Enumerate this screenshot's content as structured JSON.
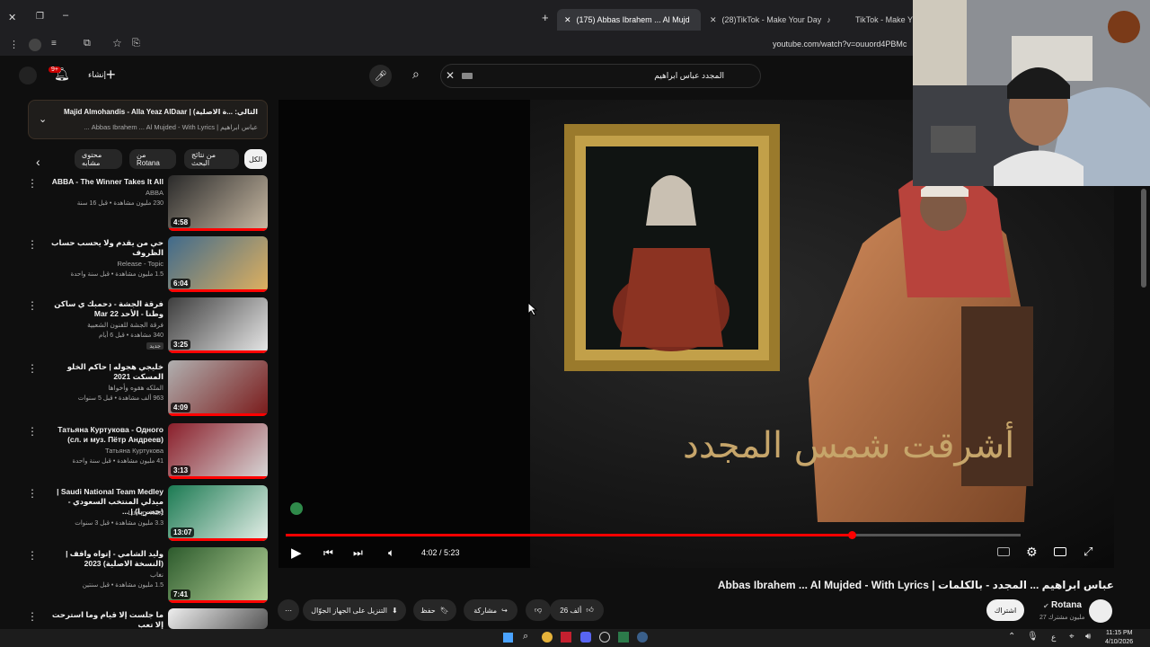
{
  "browser": {
    "tabs": [
      {
        "label": "(175) Abbas Ibrahem ... Al Mujd"
      },
      {
        "label": "(28)TikTok - Make Your Day"
      },
      {
        "label": "TikTok - Make Y"
      }
    ],
    "url": "youtube.com/watch?v=ouuord4PBMc"
  },
  "header": {
    "create_label": "إنشاء",
    "notif_count": "9+",
    "search_value": "المجدد عباس ابراهيم"
  },
  "playlist": {
    "next_label": "التالي: ...ة الاصلية) | Majid Almohandis - Alla Yeaz AlDaar",
    "sub_label": "عباس ابراهيم | Abbas Ibrahem ... Al Mujded - With Lyrics ..."
  },
  "filters": [
    "الكل",
    "من نتائج البحث",
    "من Rotana",
    "محتوى مشابه"
  ],
  "recommendations": [
    {
      "title": "ABBA - The Winner Takes It All",
      "channel": "ABBA",
      "meta": "230 مليون مشاهدة • قبل 16 سنة",
      "duration": "4:58"
    },
    {
      "title": "حي من يقدم ولا يحسب حساب الظروف",
      "channel": "Release - Topic",
      "meta": "1.5 مليون مشاهدة • قبل سنة واحدة",
      "duration": "6:04"
    },
    {
      "title": "فرقة الجشة - دحمبك ي ساكن وطنا - الأحد 22 Mar",
      "channel": "فرقة الجشة للفنون الشعبية",
      "meta": "340 مشاهدة • قبل 6 أيام",
      "duration": "3:25",
      "badge": "جديد"
    },
    {
      "title": "خليجي هجوله | حاكم الخلو المسكت 2021",
      "channel": "الملكه هقوه وأخواها",
      "meta": "963 ألف مشاهدة • قبل 5 سنوات",
      "duration": "4:09"
    },
    {
      "title": "Татьяна Куртукова - Одного (сл. и муз. Пётр Андреев)",
      "channel": "Татьяна Куртукова",
      "meta": "41 مليون مشاهدة • قبل سنة واحدة",
      "duration": "3:13"
    },
    {
      "title": "Saudi National Team Medley | ميدلي المنتخب السعودي - (حصريا) | ...",
      "channel": "Luxury KSA",
      "meta": "3.3 مليون مشاهدة • قبل 3 سنوات",
      "duration": "13:07"
    },
    {
      "title": "وليد الشامي - إتواه واقف | (النسخة الاصلية) 2023",
      "channel": "نغاب",
      "meta": "1.5 مليون مشاهدة • قبل سنتين",
      "duration": "7:41"
    },
    {
      "title": "ما جلست إلا قيام وما استرحت إلا تعب",
      "channel": "",
      "meta": "",
      "duration": ""
    }
  ],
  "player": {
    "caption": "أشرقت شمس المجدد",
    "time": "4:02 / 5:23",
    "progress": 0.77
  },
  "video": {
    "title": "عباس ابراهيم ... المجدد - بالكلمات | Abbas Ibrahem ... Al Mujded - With Lyrics",
    "channel": "Rotana",
    "subscribers": "27 مليون مشترك",
    "subscribe_label": "اشتراك",
    "likes": "26 ألف",
    "share_label": "مشاركة",
    "save_label": "حفظ",
    "download_label": "التنزيل على الجهاز الجوّال"
  },
  "taskbar": {
    "time": "11:15 PM",
    "date": "4/10/2026",
    "lang": "ع"
  }
}
